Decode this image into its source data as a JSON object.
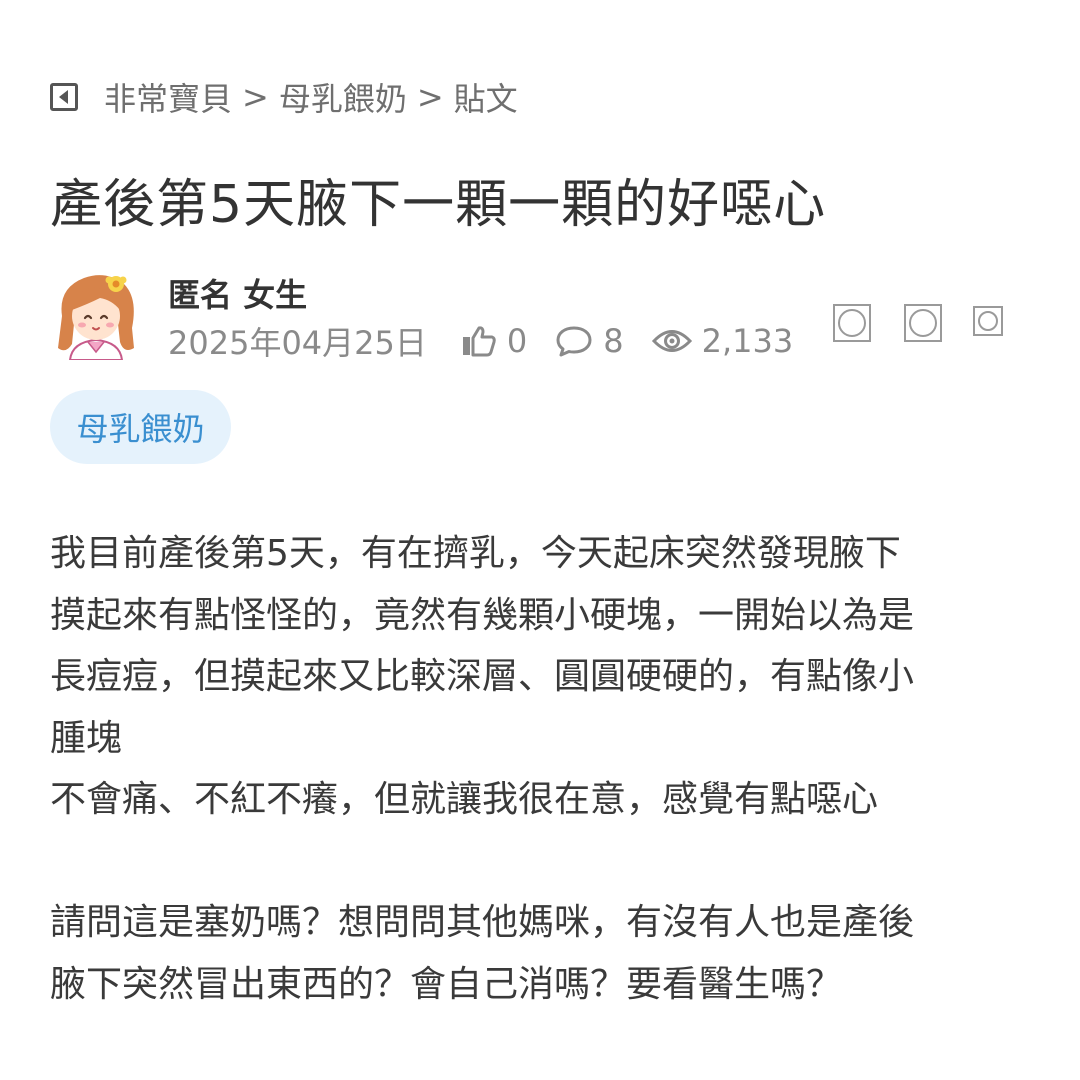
{
  "breadcrumb": {
    "items": [
      "非常寶貝",
      "母乳餵奶",
      "貼文"
    ],
    "separator": ">"
  },
  "post": {
    "title": "產後第5天腋下一顆一顆的好噁心",
    "author": "匿名 女生",
    "date": "2025年04月25日",
    "likes": "0",
    "comments": "8",
    "views": "2,133",
    "tag": "母乳餵奶",
    "body": {
      "line1": "我目前產後第5天，有在擠乳，今天起床突然發現腋下",
      "line2": "摸起來有點怪怪的，竟然有幾顆小硬塊，一開始以為是",
      "line3": "長痘痘，但摸起來又比較深層、圓圓硬硬的，有點像小",
      "line4": "腫塊",
      "line5": "不會痛、不紅不癢，但就讓我很在意，感覺有點噁心",
      "line6": "請問這是塞奶嗎？想問問其他媽咪，有沒有人也是產後",
      "line7": "腋下突然冒出東西的？會自己消嗎？要看醫生嗎？"
    }
  },
  "icons": {
    "back": "back-square-icon",
    "like": "thumbs-up-icon",
    "comment": "speech-bubble-icon",
    "views": "eye-icon"
  },
  "colors": {
    "tag_bg": "#e5f2fc",
    "tag_text": "#3a8fd0",
    "meta_text": "#8a8a8a"
  }
}
